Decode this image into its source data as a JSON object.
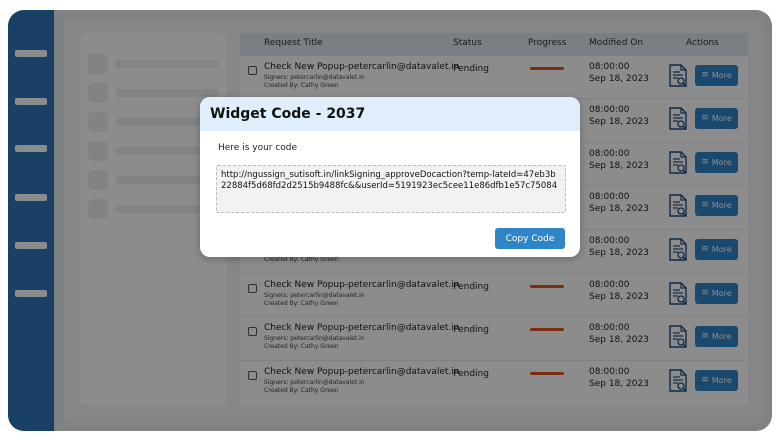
{
  "table": {
    "headers": {
      "request_title": "Request Title",
      "status": "Status",
      "progress": "Progress",
      "modified_on": "Modified On",
      "actions": "Actions"
    },
    "rows": [
      {
        "title": "Check New Popup-petercarlin@datavalet.in",
        "signers": "Signers: petercarlin@datavalet.in",
        "created_by": "Created By: Cathy Green",
        "status": "Pending",
        "time": "08:00:00",
        "date": "Sep 18, 2023",
        "more_label": "More"
      },
      {
        "title": "",
        "signers": "",
        "created_by": "",
        "status": "",
        "time": "08:00:00",
        "date": "Sep 18, 2023",
        "more_label": "More"
      },
      {
        "title": "",
        "signers": "",
        "created_by": "",
        "status": "",
        "time": "08:00:00",
        "date": "Sep 18, 2023",
        "more_label": "More"
      },
      {
        "title": "",
        "signers": "",
        "created_by": "",
        "status": "",
        "time": "08:00:00",
        "date": "Sep 18, 2023",
        "more_label": "More"
      },
      {
        "title": "",
        "signers": "",
        "created_by": "Created By: Cathy Green",
        "status": "",
        "time": "08:00:00",
        "date": "Sep 18, 2023",
        "more_label": "More"
      },
      {
        "title": "Check New Popup-petercarlin@datavalet.in",
        "signers": "Signers: petercarlin@datavalet.in",
        "created_by": "Created By: Cathy Green",
        "status": "Pending",
        "time": "08:00:00",
        "date": "Sep 18, 2023",
        "more_label": "More"
      },
      {
        "title": "Check New Popup-petercarlin@datavalet.in",
        "signers": "Signers: petercarlin@datavalet.in",
        "created_by": "Created By: Cathy Green",
        "status": "Pending",
        "time": "08:00:00",
        "date": "Sep 18, 2023",
        "more_label": "More"
      },
      {
        "title": "Check New Popup-petercarlin@datavalet.in",
        "signers": "Signers: petercarlin@datavalet.in",
        "created_by": "Created By: Cathy Green",
        "status": "Pending",
        "time": "08:00:00",
        "date": "Sep 18, 2023",
        "more_label": "More"
      }
    ]
  },
  "modal": {
    "title": "Widget Code - 2037",
    "label": "Here is your code",
    "code": "http://ngussign_sutisoft.in/linkSigning_approveDocaction?temp-lateId=47eb3b22884f5d68fd2d2515b9488fc&&userId=5191923ec5cee11e86dfb1e57c75084",
    "copy_label": "Copy Code"
  },
  "icons": {
    "document": "document-search-icon",
    "more": "hamburger-icon"
  },
  "colors": {
    "sidebar": "#2d77b9",
    "accent_button": "#2e86c9",
    "progress": "#e0521e",
    "modal_header": "#dfeefa"
  }
}
